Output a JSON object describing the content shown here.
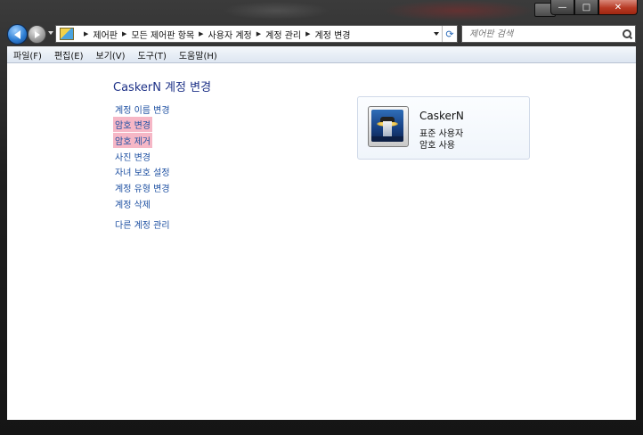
{
  "titlebar": {
    "caption_buttons": {
      "minimize": "—",
      "maximize": "□",
      "close": "✕"
    }
  },
  "nav": {
    "address_breadcrumbs": [
      "제어판",
      "모든 제어판 항목",
      "사용자 계정",
      "계정 관리",
      "계정 변경"
    ],
    "search_placeholder": "제어판 검색"
  },
  "menubar": {
    "items": [
      "파일(F)",
      "편집(E)",
      "보기(V)",
      "도구(T)",
      "도움말(H)"
    ]
  },
  "main": {
    "title": "CaskerN 계정 변경",
    "tasks": [
      {
        "label": "계정 이름 변경",
        "highlighted": false
      },
      {
        "label": "암호 변경",
        "highlighted": true
      },
      {
        "label": "암호 제거",
        "highlighted": true
      },
      {
        "label": "사진 변경",
        "highlighted": false
      },
      {
        "label": "자녀 보호 설정",
        "highlighted": false
      },
      {
        "label": "계정 유형 변경",
        "highlighted": false
      },
      {
        "label": "계정 삭제",
        "highlighted": false
      }
    ],
    "other_link": "다른 계정 관리"
  },
  "account_card": {
    "name": "CaskerN",
    "type": "표준 사용자",
    "password_status": "암호 사용",
    "avatar_icon": "lighthouse-picture"
  },
  "colors": {
    "link": "#1e50a2",
    "title": "#1e3287",
    "highlight": "#f6b7c6"
  }
}
